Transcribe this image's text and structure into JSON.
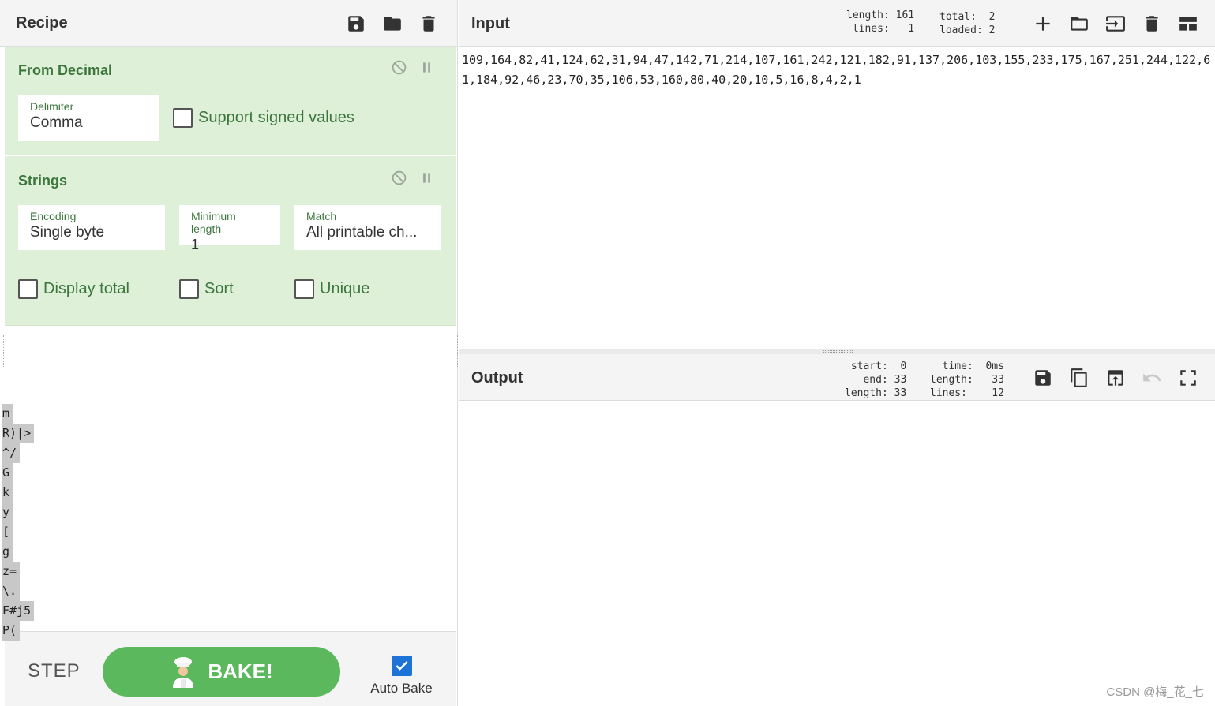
{
  "recipe": {
    "title": "Recipe",
    "operations": [
      {
        "name": "From Decimal",
        "fields": [
          {
            "label": "Delimiter",
            "value": "Comma"
          }
        ],
        "checkboxes": [
          {
            "label": "Support signed values",
            "checked": false
          }
        ]
      },
      {
        "name": "Strings",
        "fields": [
          {
            "label": "Encoding",
            "value": "Single byte"
          },
          {
            "label": "Minimum length",
            "value": "1"
          },
          {
            "label": "Match",
            "value": "All printable ch..."
          }
        ],
        "checkboxes": [
          {
            "label": "Display total",
            "checked": false
          },
          {
            "label": "Sort",
            "checked": false
          },
          {
            "label": "Unique",
            "checked": false
          }
        ]
      }
    ],
    "step_label": "STEP",
    "bake_label": "BAKE!",
    "auto_bake_label": "Auto Bake",
    "auto_bake_checked": true
  },
  "input": {
    "title": "Input",
    "stats": {
      "length_label": "length:",
      "length": "161",
      "lines_label": "lines:",
      "lines": "1",
      "total_label": "total:",
      "total": "2",
      "loaded_label": "loaded:",
      "loaded": "2"
    },
    "text": "109,164,82,41,124,62,31,94,47,142,71,214,107,161,242,121,182,91,137,206,103,155,233,175,167,251,244,122,61,184,92,46,23,70,35,106,53,160,80,40,20,10,5,16,8,4,2,1"
  },
  "output": {
    "title": "Output",
    "stats": {
      "start_label": "start:",
      "start": "0",
      "end_label": "end:",
      "end": "33",
      "length_label": "length:",
      "length": "33",
      "time_label": "time:",
      "time": "0ms",
      "length2_label": "length:",
      "length2": "33",
      "lines_label": "lines:",
      "lines": "12"
    },
    "lines": [
      "m",
      "R)|>",
      "^/",
      "G",
      "k",
      "y",
      "[",
      "g",
      "z=",
      "\\.",
      "F#j5",
      "P("
    ]
  },
  "watermark": "CSDN @梅_花_七",
  "colors": {
    "op_bg": "#dff0d8",
    "op_text": "#3c763d",
    "bake": "#5cb85c",
    "checkbox_blue": "#1d74d6"
  }
}
